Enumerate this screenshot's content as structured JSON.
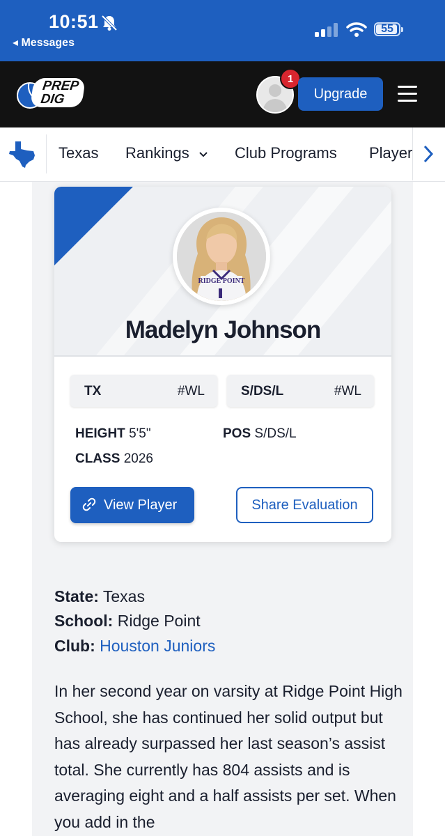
{
  "status_bar": {
    "time": "10:51",
    "back_label": "◂ Messages",
    "battery": "55"
  },
  "header": {
    "logo_text_1": "PREP",
    "logo_text_2": "DIG",
    "notification_count": "1",
    "upgrade_label": "Upgrade"
  },
  "nav": {
    "tabs": [
      {
        "label": "Texas"
      },
      {
        "label": "Rankings"
      },
      {
        "label": "Club Programs"
      },
      {
        "label": "Players"
      }
    ]
  },
  "player": {
    "name": "Madelyn Johnson",
    "jersey_text": "RIDGE POINT",
    "chips": [
      {
        "key": "TX",
        "value": "#WL"
      },
      {
        "key": "S/DS/L",
        "value": "#WL"
      }
    ],
    "height_label": "HEIGHT",
    "height_value": "5'5\"",
    "pos_label": "POS",
    "pos_value": "S/DS/L",
    "class_label": "CLASS",
    "class_value": "2026",
    "view_player_label": "View Player",
    "share_label": "Share Evaluation"
  },
  "details": {
    "state_label": "State:",
    "state_value": "Texas",
    "school_label": "School:",
    "school_value": "Ridge Point",
    "club_label": "Club:",
    "club_value": "Houston Juniors"
  },
  "bio": "In her second year on varsity at Ridge Point High School, she has continued her solid output but has already surpassed her last season’s assist total.  She currently has 804 assists and is averaging eight and a half assists per set.  When you add in the",
  "colors": {
    "brand_blue": "#1e5fbf",
    "header_black": "#121212",
    "badge_red": "#d8262f"
  }
}
